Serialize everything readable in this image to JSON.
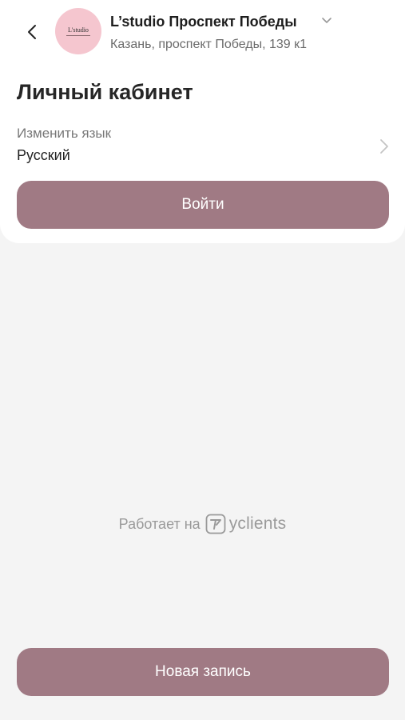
{
  "header": {
    "back_icon": "chevron-left-icon",
    "avatar_text": "L'studio",
    "salon_name": "L’studio Проспект Победы",
    "salon_chevron_icon": "chevron-down-icon",
    "address": "Казань, проспект Победы, 139 к1"
  },
  "page": {
    "title": "Личный кабинет"
  },
  "language": {
    "label": "Изменить язык",
    "value": "Русский",
    "chevron_icon": "chevron-right-icon"
  },
  "login_button": {
    "label": "Войти"
  },
  "footer": {
    "powered_text": "Работает на",
    "brand": "yclients",
    "brand_icon": "yclients-logo-icon"
  },
  "new_booking_button": {
    "label": "Новая запись"
  },
  "colors": {
    "accent": "#a07a84",
    "avatar_bg": "#f5c6cf",
    "background": "#f4f4f4",
    "card": "#ffffff"
  }
}
